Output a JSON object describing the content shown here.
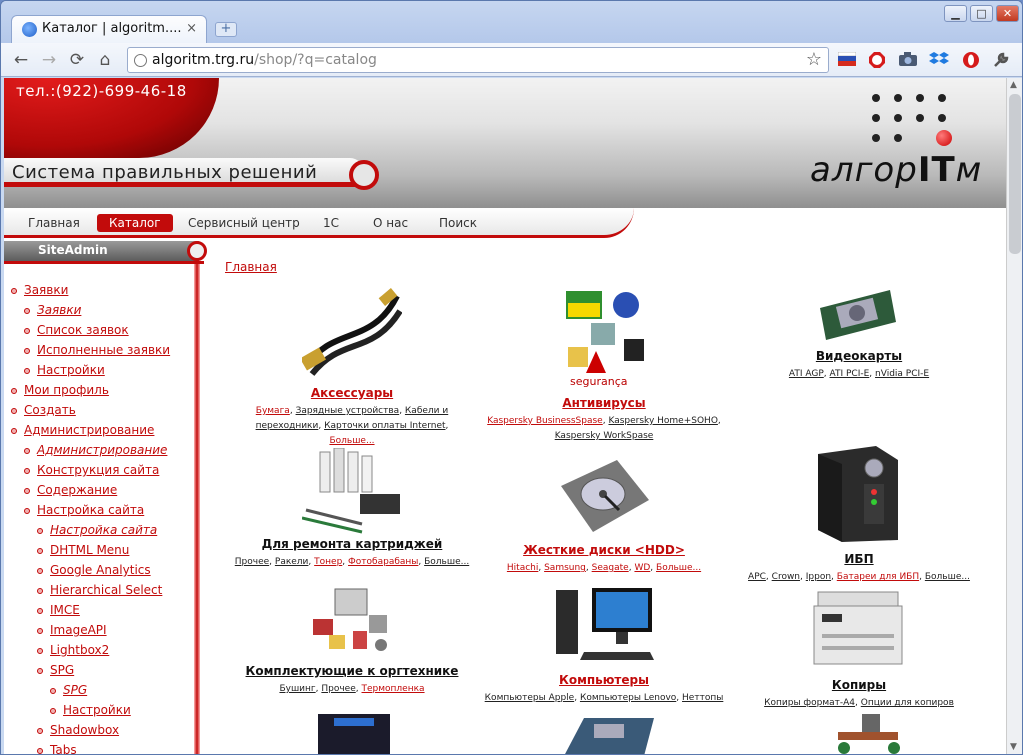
{
  "browser": {
    "tab_title": "Каталог | algoritm....",
    "tab_close": "×",
    "new_tab": "+",
    "url_host": "algoritm.trg.ru",
    "url_path": "/shop/?q=catalog",
    "nav_back": "←",
    "nav_forward": "→",
    "nav_reload": "⟳",
    "nav_home": "⌂",
    "star": "☆",
    "window_min": "▁",
    "window_max": "□",
    "window_close": "✕",
    "extensions": [
      "flag-icon",
      "adblock-icon",
      "camera-icon",
      "dropbox-icon",
      "opera-icon",
      "wrench-icon"
    ]
  },
  "site": {
    "phone": "тел.:(922)-699-46-18",
    "slogan": "Система правильных решений",
    "logo_pre": "алгор",
    "logo_mid": "IT",
    "logo_post": "м",
    "accent": "#c20b0b"
  },
  "menu": [
    {
      "label": "Главная",
      "active": false
    },
    {
      "label": "Каталог",
      "active": true
    },
    {
      "label": "Сервисный центр",
      "active": false
    },
    {
      "label": "1С",
      "active": false
    },
    {
      "label": "О нас",
      "active": false
    },
    {
      "label": "Поиск",
      "active": false
    }
  ],
  "sidebar": {
    "title": "SiteAdmin",
    "items": [
      {
        "label": "Заявки",
        "level": 0,
        "em": false
      },
      {
        "label": "Заявки",
        "level": 1,
        "em": true
      },
      {
        "label": "Список заявок",
        "level": 1,
        "em": false
      },
      {
        "label": "Исполненные заявки",
        "level": 1,
        "em": false
      },
      {
        "label": "Настройки",
        "level": 1,
        "em": false
      },
      {
        "label": "Мои профиль",
        "level": 0,
        "em": false
      },
      {
        "label": "Создать",
        "level": 0,
        "em": false
      },
      {
        "label": "Администрирование",
        "level": 0,
        "em": false
      },
      {
        "label": "Администрирование",
        "level": 1,
        "em": true
      },
      {
        "label": "Конструкция сайта",
        "level": 1,
        "em": false
      },
      {
        "label": "Содержание",
        "level": 1,
        "em": false
      },
      {
        "label": "Настройка сайта",
        "level": 1,
        "em": false
      },
      {
        "label": "Настройка сайта",
        "level": 2,
        "em": true
      },
      {
        "label": "DHTML Menu",
        "level": 2,
        "em": false
      },
      {
        "label": "Google Analytics",
        "level": 2,
        "em": false
      },
      {
        "label": "Hierarchical Select",
        "level": 2,
        "em": false
      },
      {
        "label": "IMCE",
        "level": 2,
        "em": false
      },
      {
        "label": "ImageAPI",
        "level": 2,
        "em": false
      },
      {
        "label": "Lightbox2",
        "level": 2,
        "em": false
      },
      {
        "label": "SPG",
        "level": 2,
        "em": false
      },
      {
        "label": "SPG",
        "level": 3,
        "em": true
      },
      {
        "label": "Настройки",
        "level": 3,
        "em": false
      },
      {
        "label": "Shadowbox",
        "level": 2,
        "em": false
      },
      {
        "label": "Tabs",
        "level": 2,
        "em": false
      }
    ]
  },
  "breadcrumb": "Главная",
  "catalog": {
    "accessories": {
      "title": "Аксессуары",
      "links": [
        "Бумага",
        "Зарядные устройства",
        "Кабели и переходники",
        "Карточки оплаты Internet",
        "Больше..."
      ]
    },
    "antivirus": {
      "title": "Антивирусы",
      "links": [
        "Kaspersky BusinessSpase",
        "Kaspersky Home+SOHO",
        "Kaspersky WorkSpase"
      ]
    },
    "videocards": {
      "title": "Видеокарты",
      "links": [
        "ATI AGP",
        "ATI PCI-E",
        "nVidia PCI-E"
      ]
    },
    "cartridge": {
      "title": "Для ремонта картриджей",
      "links": [
        "Прочее",
        "Ракели",
        "Тонер",
        "Фотобарабаны",
        "Больше..."
      ]
    },
    "hdd": {
      "title": "Жесткие диски <HDD>",
      "links": [
        "Hitachi",
        "Samsung",
        "Seagate",
        "WD",
        "Больше..."
      ]
    },
    "ups": {
      "title": "ИБП",
      "links": [
        "APC",
        "Crown",
        "Ippon",
        "Батареи для ИБП",
        "Больше..."
      ]
    },
    "office_parts": {
      "title": "Комплектующие к оргтехнике",
      "links": [
        "Бушинг",
        "Прочее",
        "Термопленка"
      ]
    },
    "computers": {
      "title": "Компьютеры",
      "links": [
        "Компьютеры Apple",
        "Компьютеры Lenovo",
        "Неттопы"
      ]
    },
    "copiers": {
      "title": "Копиры",
      "links": [
        "Копиры формат-А4",
        "Опции для копиров"
      ]
    }
  }
}
